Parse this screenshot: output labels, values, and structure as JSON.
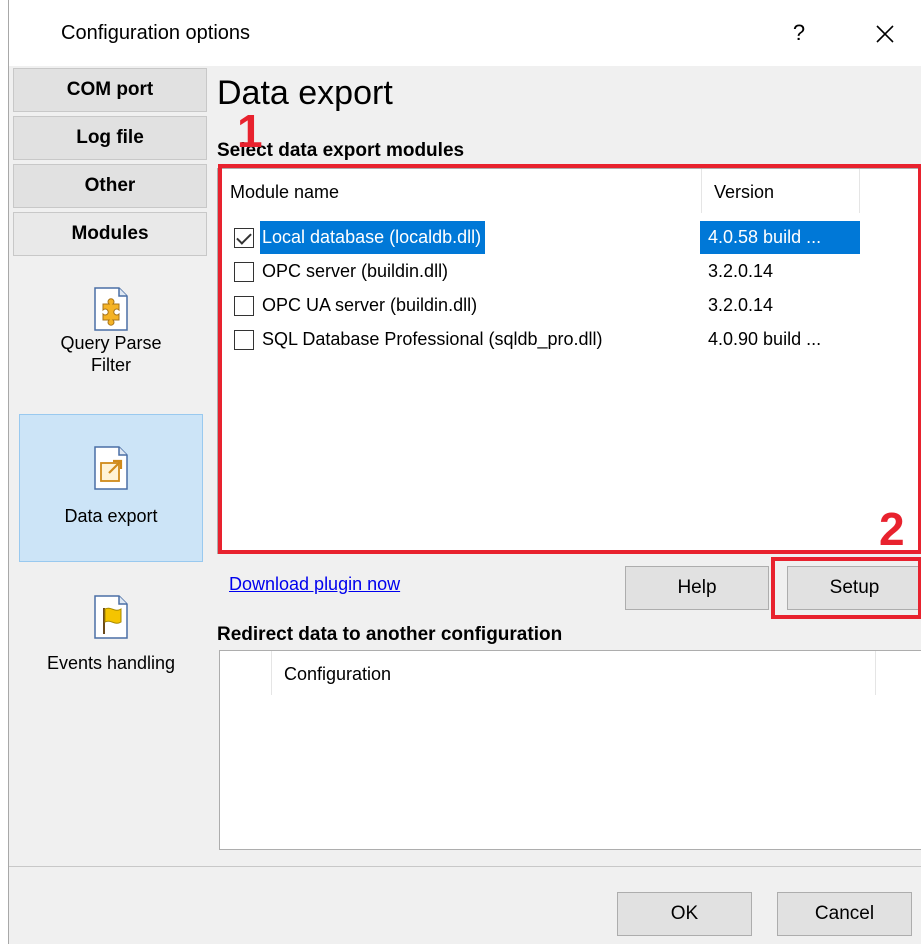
{
  "window": {
    "title": "Configuration options",
    "help_glyph": "?",
    "close_icon": "close-icon"
  },
  "sidebar": {
    "buttons": [
      {
        "label": "COM port"
      },
      {
        "label": "Log file"
      },
      {
        "label": "Other"
      },
      {
        "label": "Modules"
      }
    ],
    "tools": [
      {
        "label_line1": "Query Parse",
        "label_line2": "Filter",
        "icon": "puzzle-icon"
      },
      {
        "label_line1": "Data export",
        "label_line2": "",
        "icon": "export-icon",
        "selected": true
      },
      {
        "label_line1": "Events handling",
        "label_line2": "",
        "icon": "flag-icon"
      }
    ]
  },
  "main": {
    "title": "Data export",
    "modules_section": "Select data export modules",
    "modules_table": {
      "columns": [
        "Module name",
        "Version"
      ],
      "rows": [
        {
          "checked": true,
          "name": "Local database (localdb.dll)",
          "version": "4.0.58 build ...",
          "selected": true
        },
        {
          "checked": false,
          "name": "OPC server (buildin.dll)",
          "version": "3.2.0.14"
        },
        {
          "checked": false,
          "name": "OPC UA server (buildin.dll)",
          "version": "3.2.0.14"
        },
        {
          "checked": false,
          "name": "SQL Database Professional (sqldb_pro.dll)",
          "version": "4.0.90 build ..."
        }
      ]
    },
    "download_link": "Download plugin now",
    "help_button": "Help",
    "setup_button": "Setup",
    "redirect_section": "Redirect data to another configuration",
    "redirect_table": {
      "columns": [
        "Configuration"
      ]
    }
  },
  "footer": {
    "ok_button": "OK",
    "cancel_button": "Cancel"
  },
  "annotations": {
    "marker_1": "1",
    "marker_2": "2",
    "color": "#e8222e"
  },
  "colors": {
    "selection": "#0078d7",
    "sidebar_selected": "#cce4f7",
    "link": "#0000ee"
  }
}
